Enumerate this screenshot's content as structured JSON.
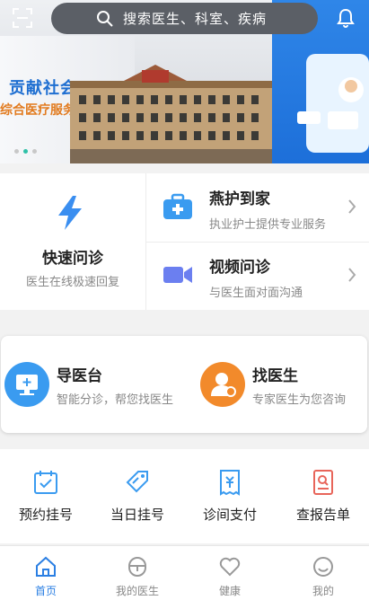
{
  "header": {
    "search_placeholder": "搜索医生、科室、疾病",
    "icons": {
      "scan": "scan-icon",
      "search": "search-icon",
      "notification": "bell-icon"
    }
  },
  "banner": {
    "slogan_line1": "贡献社会",
    "slogan_line2": "综合医疗服务",
    "carousel_active_index": 1,
    "carousel_count": 3
  },
  "services": {
    "quick": {
      "title": "快速问诊",
      "subtitle": "医生在线极速回复",
      "icon": "lightning-icon"
    },
    "rows": [
      {
        "title": "燕护到家",
        "subtitle": "执业护士提供专业服务",
        "icon": "medical-kit-icon"
      },
      {
        "title": "视频问诊",
        "subtitle": "与医生面对面沟通",
        "icon": "video-camera-icon"
      }
    ]
  },
  "guide": [
    {
      "title": "导医台",
      "subtitle": "智能分诊，帮您找医生",
      "icon": "monitor-icon",
      "color": "#3a9bf0"
    },
    {
      "title": "找医生",
      "subtitle": "专家医生为您咨询",
      "icon": "doctor-icon",
      "color": "#f28a2b"
    }
  ],
  "quick_actions": [
    {
      "label": "预约挂号",
      "icon": "calendar-check-icon"
    },
    {
      "label": "当日挂号",
      "icon": "tag-icon"
    },
    {
      "label": "诊间支付",
      "icon": "receipt-yen-icon"
    },
    {
      "label": "查报告单",
      "icon": "report-search-icon"
    }
  ],
  "tabbar": {
    "active": 0,
    "tabs": [
      {
        "label": "首页",
        "icon": "home-icon"
      },
      {
        "label": "我的医生",
        "icon": "doctor-tab-icon"
      },
      {
        "label": "健康",
        "icon": "heart-icon"
      },
      {
        "label": "我的",
        "icon": "smile-icon"
      }
    ]
  },
  "colors": {
    "primary": "#2b7fe3",
    "orange": "#f28a2b",
    "accent_blue": "#3a9bf0"
  }
}
